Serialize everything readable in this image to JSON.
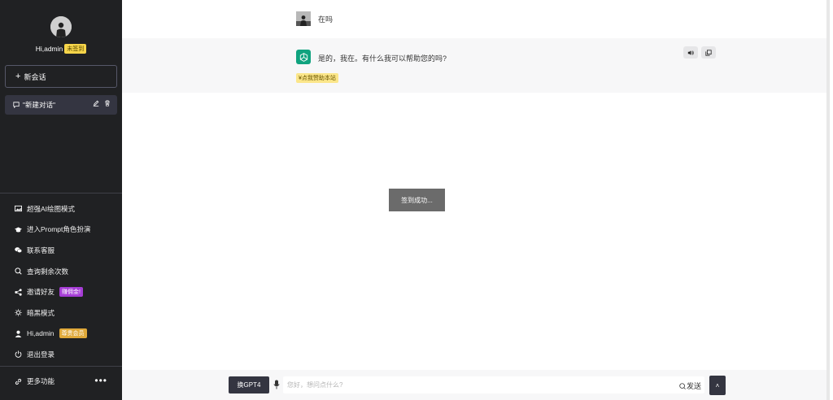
{
  "sidebar": {
    "user_greeting": "Hi,admin",
    "signin_badge": "未签到",
    "new_chat_label": "新会话",
    "conversations": [
      {
        "title": "\"新建对话\""
      }
    ],
    "menu": [
      {
        "label": "超强AI绘图模式",
        "icon": "image-icon"
      },
      {
        "label": "进入Prompt角色扮演",
        "icon": "graduation-cap-icon"
      },
      {
        "label": "联系客服",
        "icon": "wechat-icon"
      },
      {
        "label": "查询剩余次数",
        "icon": "search-icon"
      },
      {
        "label": "邀请好友",
        "icon": "share-icon",
        "badge": "赚佣金!"
      },
      {
        "label": "暗黑模式",
        "icon": "sun-icon"
      },
      {
        "label": "Hi,admin",
        "icon": "user-icon",
        "badge": "尊贵会员"
      },
      {
        "label": "退出登录",
        "icon": "power-icon"
      }
    ],
    "more_label": "更多功能",
    "colors": {
      "background": "#202123",
      "purple_badge": "#a63dd6",
      "orange_badge": "#e0a93a",
      "yellow_badge": "#f6d54a"
    }
  },
  "chat": {
    "user_message": "在吗",
    "bot_message": "是的，我在。有什么我可以帮助您的吗?",
    "sponsor_label": "¥点我赞助本站",
    "bot_accent": "#10a37f"
  },
  "toast": {
    "text": "签到成功..."
  },
  "input": {
    "model_button": "换GPT4",
    "placeholder": "您好，想问点什么?",
    "send_label": "发送"
  }
}
